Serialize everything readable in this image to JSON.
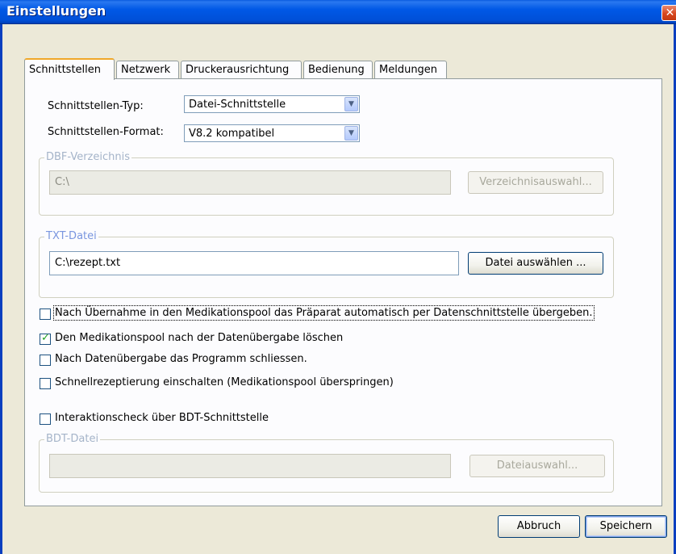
{
  "window": {
    "title": "Einstellungen",
    "close_glyph": "✕"
  },
  "tabs": [
    {
      "label": "Schnittstellen",
      "active": true
    },
    {
      "label": "Netzwerk",
      "active": false
    },
    {
      "label": "Druckerausrichtung",
      "active": false
    },
    {
      "label": "Bedienung",
      "active": false
    },
    {
      "label": "Meldungen",
      "active": false
    }
  ],
  "interface_type": {
    "label": "Schnittstellen-Typ:",
    "value": "Datei-Schnittstelle"
  },
  "interface_format": {
    "label": "Schnittstellen-Format:",
    "value": "V8.2 kompatibel"
  },
  "dbf_group": {
    "legend": "DBF-Verzeichnis",
    "path": "C:\\",
    "button": "Verzeichnisauswahl..."
  },
  "txt_group": {
    "legend": "TXT-Datei",
    "path": "C:\\rezept.txt",
    "button": "Datei auswählen ..."
  },
  "checkboxes": [
    {
      "label": "Nach Übernahme in den Medikationspool das Präparat automatisch per Datenschnittstelle übergeben.",
      "checked": false
    },
    {
      "label": "Den Medikationspool nach der Datenübergabe löschen",
      "checked": true
    },
    {
      "label": "Nach Datenübergabe das Programm schliessen.",
      "checked": false
    },
    {
      "label": "Schnellrezeptierung einschalten (Medikationspool überspringen)",
      "checked": false
    },
    {
      "label": "Interaktionscheck über BDT-Schnittstelle",
      "checked": false
    }
  ],
  "bdt_group": {
    "legend": "BDT-Datei",
    "path": "",
    "button": "Dateiauswahl..."
  },
  "footer": {
    "cancel": "Abbruch",
    "save": "Speichern"
  },
  "colors": {
    "titlebar": "#0058e6",
    "accent_tab": "#f0a82a",
    "check": "#21a121"
  },
  "icons": {
    "dropdown": "chevron-down-icon",
    "close": "close-icon",
    "check": "checkmark-icon"
  }
}
